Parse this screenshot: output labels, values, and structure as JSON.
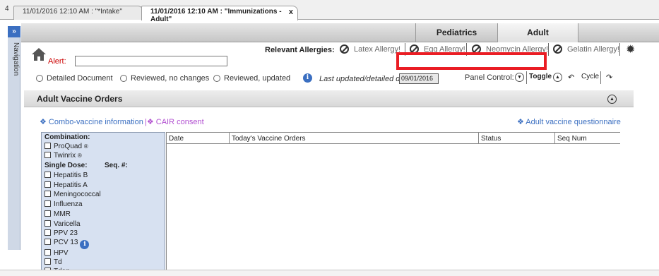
{
  "doc_tabs": {
    "scroll_glyph": "4",
    "intake": "11/01/2016 12:10 AM : \"*Intake\"",
    "immunizations": "11/01/2016 12:10 AM : \"Immunizations - Adult\"",
    "close_glyph": "x"
  },
  "nav": {
    "expand_glyph": "»",
    "label": "Navigation"
  },
  "panel_tabs": {
    "pediatrics": "Pediatrics",
    "adult": "Adult"
  },
  "alert": {
    "label": "Alert:",
    "value": ""
  },
  "allergies": {
    "title": "Relevant Allergies:",
    "items": [
      "Latex Allergy!",
      "Egg Allergy!",
      "Neomycin Allergy!",
      "Gelatin Allergy!"
    ]
  },
  "review": {
    "options": [
      "Detailed Document",
      "Reviewed, no changes",
      "Reviewed, updated"
    ],
    "last_updated_label": "Last updated/detailed doc:",
    "last_updated_value": "09/01/2016"
  },
  "panel_control": {
    "label": "Panel Control:",
    "toggle": "Toggle",
    "cycle": "Cycle"
  },
  "section": {
    "title": "Adult Vaccine Orders"
  },
  "links": {
    "combo": "❖ Combo-vaccine information",
    "cair": "|❖ CAIR consent",
    "questionnaire": "❖ Adult vaccine questionnaire"
  },
  "vaccines": {
    "combination_header": "Combination:",
    "combination": [
      "ProQuad",
      "Twinrix"
    ],
    "single_header": "Single Dose:",
    "seq_header": "Seq. #:",
    "single": [
      "Hepatitis B",
      "Hepatitis A",
      "Meningococcal",
      "Influenza",
      "MMR",
      "Varicella",
      "PPV 23",
      "PCV 13",
      "HPV",
      "Td",
      "Tdap"
    ]
  },
  "orders_table": {
    "columns": [
      "Date",
      "Today's Vaccine Orders",
      "Status",
      "Seq Num"
    ]
  },
  "colors": {
    "highlight_box": "#ea1d24",
    "link": "#3b6fc1",
    "cair_link": "#b14fd0",
    "vaccine_panel": "#d7e1f1"
  }
}
